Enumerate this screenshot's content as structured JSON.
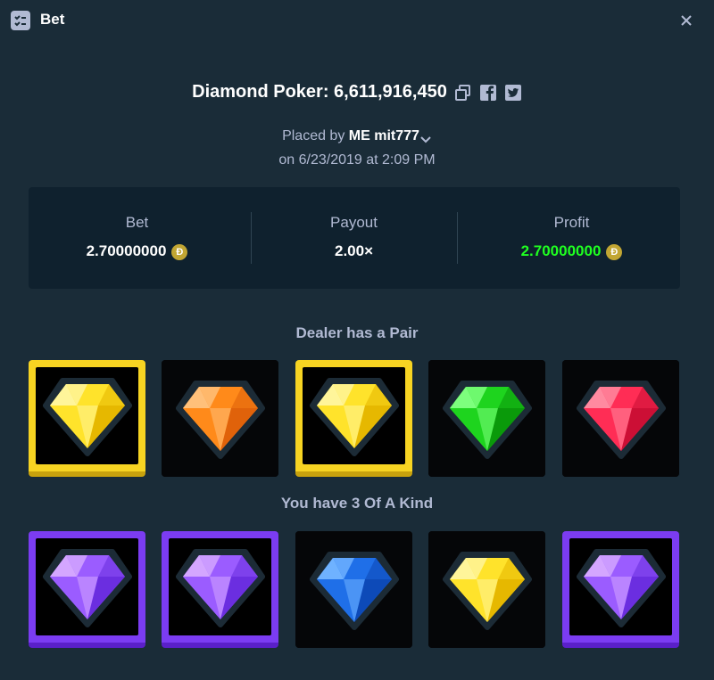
{
  "header": {
    "title": "Bet",
    "icon": "bet-list-icon",
    "close_icon": "close-icon"
  },
  "game": {
    "title": "Diamond Poker: 6,611,916,450",
    "copy_icon": "copy-icon",
    "facebook_icon": "facebook-icon",
    "twitter_icon": "twitter-icon"
  },
  "placed": {
    "prefix": "Placed by",
    "me": "ME",
    "user": "mit777",
    "date_line": "on 6/23/2019 at 2:09 PM"
  },
  "stats": {
    "bet_label": "Bet",
    "bet_value": "2.70000000",
    "payout_label": "Payout",
    "payout_value": "2.00×",
    "profit_label": "Profit",
    "profit_value": "2.70000000",
    "currency_symbol": "Đ",
    "profit_color": "#1fff20",
    "coin_color": "#c2a633"
  },
  "dealer": {
    "label": "Dealer has a Pair",
    "cards": [
      {
        "gem": "yellow",
        "highlight": "yellow"
      },
      {
        "gem": "orange",
        "highlight": "none"
      },
      {
        "gem": "yellow",
        "highlight": "yellow"
      },
      {
        "gem": "green",
        "highlight": "none"
      },
      {
        "gem": "red",
        "highlight": "none"
      }
    ]
  },
  "player": {
    "label": "You have 3 Of A Kind",
    "cards": [
      {
        "gem": "purple",
        "highlight": "purple"
      },
      {
        "gem": "purple",
        "highlight": "purple"
      },
      {
        "gem": "blue",
        "highlight": "none"
      },
      {
        "gem": "yellow",
        "highlight": "none"
      },
      {
        "gem": "purple",
        "highlight": "purple"
      }
    ]
  },
  "colors": {
    "background": "#1a2c38",
    "panel": "#0f212e",
    "yellow_highlight": "#f7d422",
    "purple_highlight": "#7b3cf2"
  }
}
